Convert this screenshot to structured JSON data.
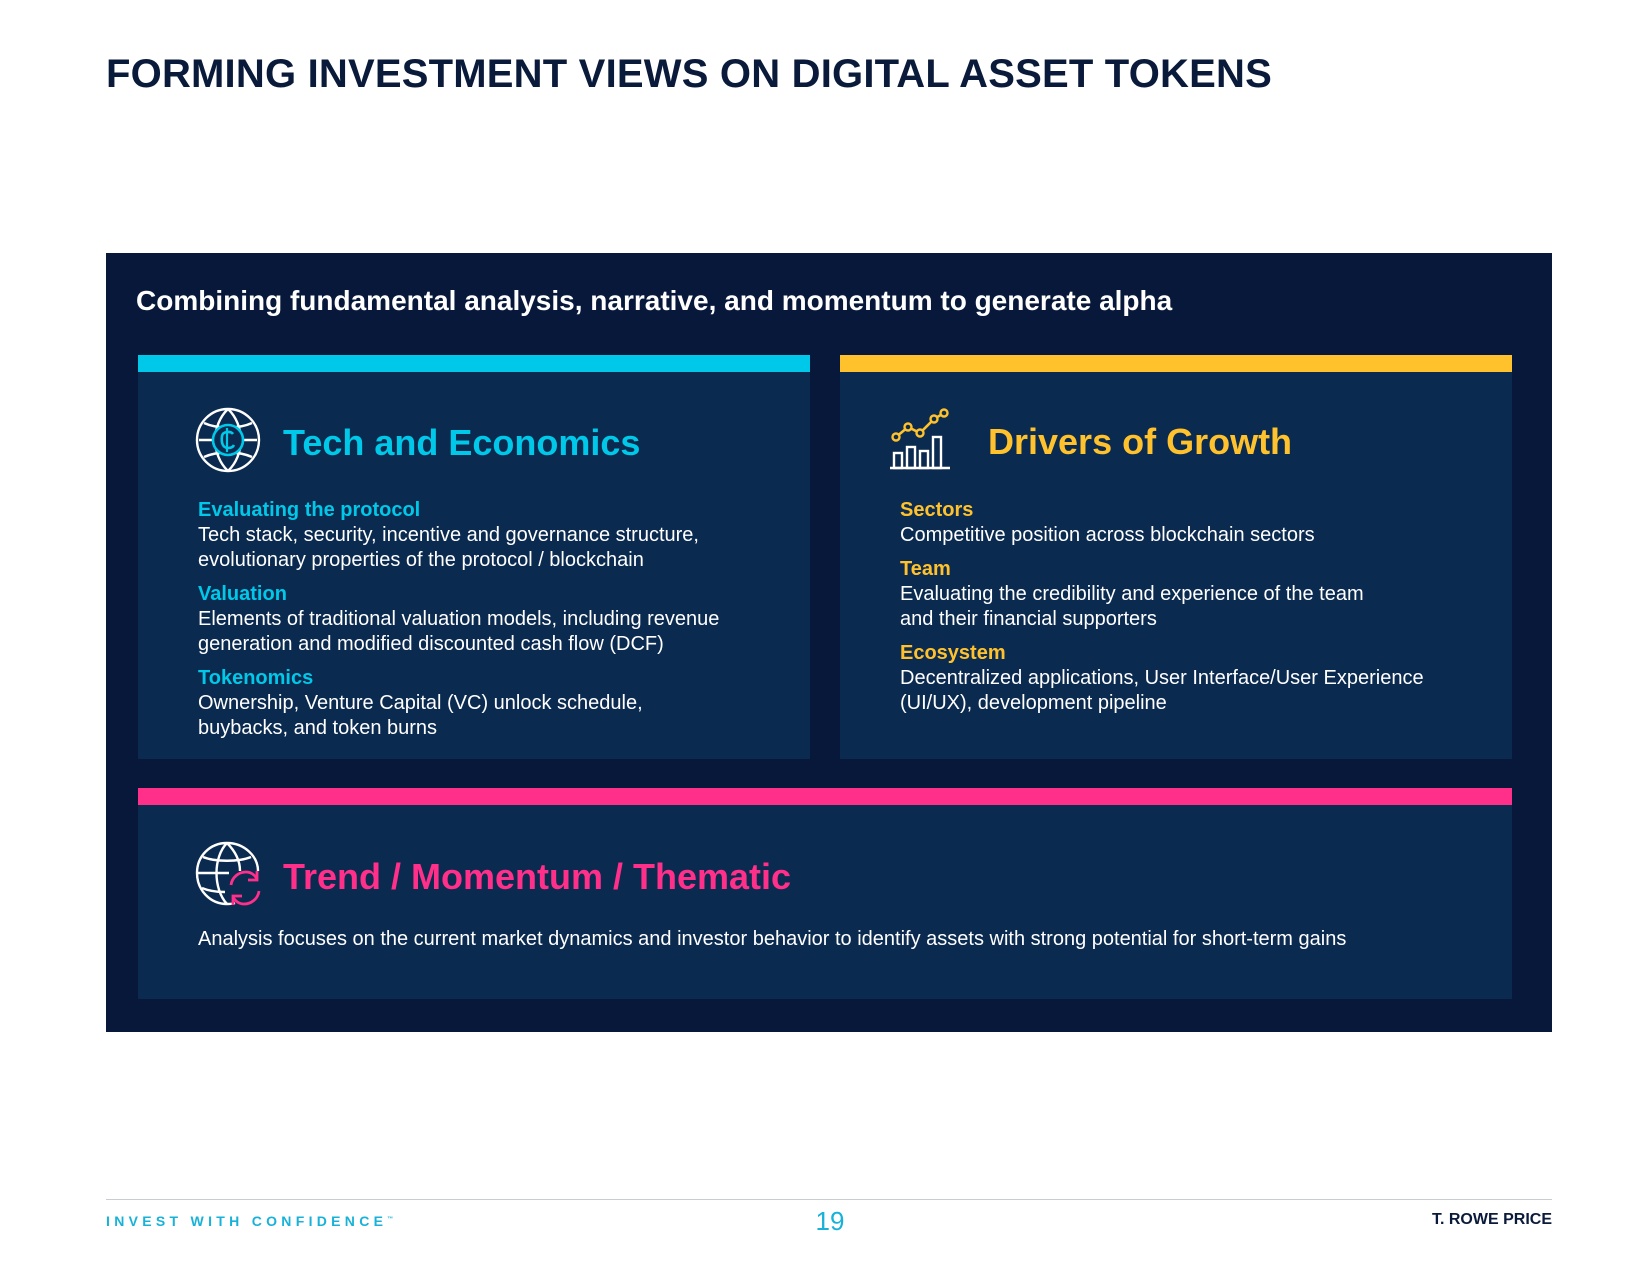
{
  "page": {
    "title": "FORMING INVESTMENT VIEWS ON DIGITAL ASSET TOKENS",
    "subtitle": "Combining fundamental analysis, narrative, and momentum to generate alpha"
  },
  "colors": {
    "navy_panel": "#07183a",
    "card_bg": "#0b2a50",
    "cyan": "#00c8e8",
    "yellow": "#ffc22d",
    "pink": "#ff2f8a"
  },
  "cards": {
    "tech": {
      "title": "Tech and Economics",
      "icon": "crypto-globe-icon",
      "items": [
        {
          "heading": "Evaluating the protocol",
          "text": "Tech stack, security, incentive and governance structure,\nevolutionary properties of the protocol / blockchain"
        },
        {
          "heading": "Valuation",
          "text": "Elements of traditional valuation models, including revenue\ngeneration and modified discounted cash flow (DCF)"
        },
        {
          "heading": "Tokenomics",
          "text": "Ownership, Venture Capital (VC) unlock schedule,\nbuybacks, and token burns"
        }
      ]
    },
    "growth": {
      "title": "Drivers of Growth",
      "icon": "growth-chart-icon",
      "items": [
        {
          "heading": "Sectors",
          "text": "Competitive position across blockchain sectors"
        },
        {
          "heading": "Team",
          "text": "Evaluating the credibility and experience of the team\nand their financial supporters"
        },
        {
          "heading": "Ecosystem",
          "text": "Decentralized applications, User Interface/User Experience\n(UI/UX), development pipeline"
        }
      ]
    },
    "trend": {
      "title": "Trend / Momentum / Thematic",
      "icon": "globe-refresh-icon",
      "text": "Analysis focuses on the current market dynamics and investor behavior to identify assets with strong potential for short-term gains"
    }
  },
  "footer": {
    "tagline": "INVEST WITH CONFIDENCE",
    "tm": "™",
    "page_number": "19",
    "brand": "T. ROWE PRICE"
  }
}
